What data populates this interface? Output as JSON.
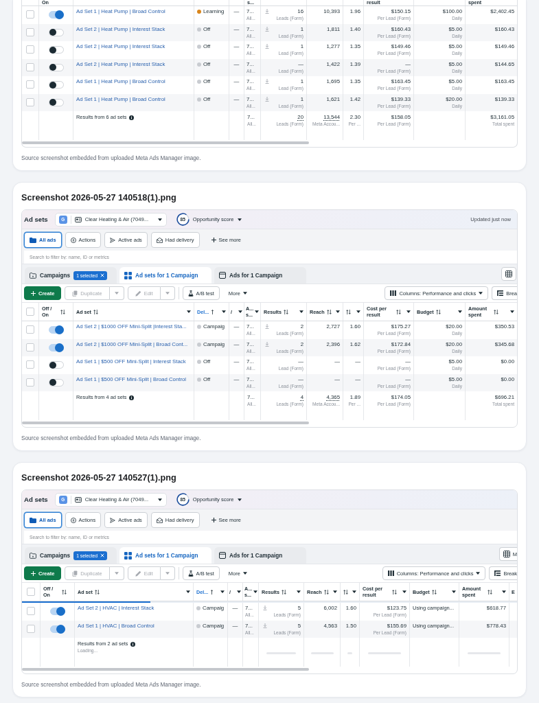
{
  "cards": [
    {
      "table": {
        "columns": [
          {
            "kind": "cut"
          },
          {
            "kind": "cut",
            "label": "On"
          },
          {
            "kind": "cut"
          },
          {
            "kind": "cut"
          },
          {
            "kind": "cut"
          },
          {
            "kind": "cut",
            "label": "s..."
          },
          {
            "kind": "cut"
          },
          {
            "kind": "cut"
          },
          {
            "kind": "cut"
          },
          {
            "kind": "cut",
            "label": "result"
          },
          {
            "kind": "cut"
          },
          {
            "kind": "cut",
            "label": "spent"
          }
        ],
        "rows": [
          {
            "selected": false,
            "on": true,
            "name": "Ad Set 1 | Heat Pump | Broad Control",
            "delivery": {
              "label": "Learning",
              "color": "#d9861c"
            },
            "column_5": "—",
            "column_6": {
              "value": "7...",
              "sub": "All..."
            },
            "results": {
              "value": "16",
              "sub": "Leads (Form)",
              "icon": true
            },
            "reach": "10,393",
            "column_9": "1.96",
            "cost_per_result": {
              "value": "$150.15",
              "sub": "Per Lead (Form)"
            },
            "budget": {
              "value": "$100.00",
              "sub": "Daily"
            },
            "amount_spent": "$2,402.45"
          },
          {
            "selected": false,
            "on": false,
            "name": "Ad Set 2 | Heat Pump | Interest Stack",
            "delivery": {
              "label": "Off",
              "color": "#c9ccd1"
            },
            "column_5": "—",
            "column_6": {
              "value": "7...",
              "sub": "All..."
            },
            "results": {
              "value": "1",
              "sub": "Lead (Form)",
              "icon": true
            },
            "reach": "1,811",
            "column_9": "1.40",
            "cost_per_result": {
              "value": "$160.43",
              "sub": "Per Lead (Form)"
            },
            "budget": {
              "value": "$5.00",
              "sub": "Daily"
            },
            "amount_spent": "$160.43"
          },
          {
            "selected": false,
            "on": false,
            "name": "Ad Set 2 | Heat Pump | Interest Stack",
            "delivery": {
              "label": "Off",
              "color": "#c9ccd1"
            },
            "column_5": "—",
            "column_6": {
              "value": "7...",
              "sub": "All..."
            },
            "results": {
              "value": "1",
              "sub": "Lead (Form)",
              "icon": true
            },
            "reach": "1,277",
            "column_9": "1.35",
            "cost_per_result": {
              "value": "$149.46",
              "sub": "Per Lead (Form)"
            },
            "budget": {
              "value": "$5.00",
              "sub": "Daily"
            },
            "amount_spent": "$149.46"
          },
          {
            "selected": false,
            "on": false,
            "name": "Ad Set 2 | Heat Pump | Interest Stack",
            "delivery": {
              "label": "Off",
              "color": "#c9ccd1"
            },
            "column_5": "—",
            "column_6": {
              "value": "7...",
              "sub": "All..."
            },
            "results": {
              "value": "—",
              "sub": "Lead (Form)",
              "icon": false
            },
            "reach": "1,422",
            "column_9": "1.39",
            "cost_per_result": {
              "value": "—",
              "sub": "Per Lead (Form)"
            },
            "budget": {
              "value": "$5.00",
              "sub": "Daily"
            },
            "amount_spent": "$144.65"
          },
          {
            "selected": false,
            "on": false,
            "name": "Ad Set 1 | Heat Pump | Broad Control",
            "delivery": {
              "label": "Off",
              "color": "#c9ccd1"
            },
            "column_5": "—",
            "column_6": {
              "value": "7...",
              "sub": "All..."
            },
            "results": {
              "value": "1",
              "sub": "Lead (Form)",
              "icon": true
            },
            "reach": "1,695",
            "column_9": "1.35",
            "cost_per_result": {
              "value": "$163.45",
              "sub": "Per Lead (Form)"
            },
            "budget": {
              "value": "$5.00",
              "sub": "Daily"
            },
            "amount_spent": "$163.45"
          },
          {
            "selected": false,
            "on": false,
            "name": "Ad Set 1 | Heat Pump | Broad Control",
            "delivery": {
              "label": "Off",
              "color": "#c9ccd1"
            },
            "column_5": "—",
            "column_6": {
              "value": "7...",
              "sub": "All..."
            },
            "results": {
              "value": "1",
              "sub": "Lead (Form)",
              "icon": true
            },
            "reach": "1,621",
            "column_9": "1.42",
            "cost_per_result": {
              "value": "$139.33",
              "sub": "Per Lead (Form)"
            },
            "budget": {
              "value": "$20.00",
              "sub": "Daily"
            },
            "amount_spent": "$139.33"
          }
        ],
        "totals": {
          "label": "Results from 6 ad sets",
          "loading": false,
          "column_6": {
            "value": "7...",
            "sub": "All..."
          },
          "results": {
            "value": "20",
            "sub": "Leads (Form)"
          },
          "reach": {
            "value": "13,544",
            "sub": "Meta Accou..."
          },
          "column_9": {
            "value": "2.30",
            "sub": "Per ..."
          },
          "cost_per_result": {
            "value": "$158.05",
            "sub": "Per Lead (Form)"
          },
          "amount_spent": {
            "value": "$3,161.05",
            "sub": "Total spent"
          }
        }
      },
      "caption": "Source screenshot embedded from uploaded Meta Ads Manager image."
    },
    {
      "title": "Screenshot 2026-05-27 140518(1).png",
      "top_bar": {
        "title": "Ad sets",
        "account": {
          "initial": "G",
          "name": "Clear Heating & Air (7049..."
        },
        "score": {
          "value": "85",
          "label": "Opportunity score"
        },
        "status": "Updated just now"
      },
      "filters": [
        {
          "label": "All ads",
          "selected": true
        },
        {
          "label": "Actions",
          "selected": false
        },
        {
          "label": "Active ads",
          "selected": false
        },
        {
          "label": "Had delivery",
          "selected": false
        }
      ],
      "see_more": "See more",
      "search": {
        "placeholder": "Search to filter by: name, ID or metrics"
      },
      "tabs": [
        {
          "label": "Campaigns",
          "selected": false,
          "badge": "1 selected"
        },
        {
          "label": "Ad sets for 1 Campaign",
          "selected": true
        },
        {
          "label": "Ads for 1 Campaign",
          "selected": false
        }
      ],
      "toolbar": {
        "create": "Create",
        "duplicate": {
          "label": "Duplicate",
          "disabled": true
        },
        "edit": {
          "label": "Edit",
          "disabled": true
        },
        "ab_test": "A/B test",
        "more": "More",
        "columns": "Columns: Performance and clicks",
        "breakdown": "Brea"
      },
      "table": {
        "columns": [
          {
            "kind": "check",
            "checked": false
          },
          {
            "kind": "head",
            "label": "Off / On",
            "sortable": true,
            "sorted": false,
            "menu": false
          },
          {
            "kind": "head",
            "label": "Ad set",
            "sortable": true,
            "sorted": false,
            "menu": true
          },
          {
            "kind": "head",
            "label": "Del...",
            "sortable": false,
            "sorted": true,
            "menu": true
          },
          {
            "kind": "head",
            "label": "/",
            "sortable": false,
            "sorted": false,
            "menu": true
          },
          {
            "kind": "head",
            "label": "A... s...",
            "sortable": false,
            "sorted": false,
            "menu": true
          },
          {
            "kind": "head",
            "label": "Results",
            "sortable": true,
            "sorted": false,
            "menu": true
          },
          {
            "kind": "head",
            "label": "Reach",
            "sortable": true,
            "sorted": false,
            "menu": true
          },
          {
            "kind": "head",
            "sortable": true,
            "sorted": false,
            "menu": true
          },
          {
            "kind": "head",
            "label": "Cost per result",
            "sortable": true,
            "sorted": false,
            "menu": true
          },
          {
            "kind": "head",
            "label": "Budget",
            "sortable": true,
            "sorted": false,
            "menu": true
          },
          {
            "kind": "head",
            "label": "Amount spent",
            "sortable": true,
            "sorted": false,
            "menu": true
          }
        ],
        "rows": [
          {
            "selected": false,
            "on": true,
            "name": "Ad Set 2 | $1000 OFF Mini-Split |Interest Sta...",
            "delivery": {
              "label": "Campaig",
              "color": "#c9ccd1"
            },
            "column_5": "—",
            "column_6": {
              "value": "7...",
              "sub": "All..."
            },
            "results": {
              "value": "2",
              "sub": "Leads (Form)",
              "icon": true
            },
            "reach": "2,727",
            "column_9": "1.60",
            "cost_per_result": {
              "value": "$175.27",
              "sub": "Per Lead (Form)"
            },
            "budget": {
              "value": "$20.00",
              "sub": "Daily"
            },
            "amount_spent": "$350.53"
          },
          {
            "selected": false,
            "on": true,
            "name": "Ad Set 2 | $1000 OFF Mini-Split | Broad Cont...",
            "delivery": {
              "label": "Campaig",
              "color": "#c9ccd1"
            },
            "column_5": "—",
            "column_6": {
              "value": "7...",
              "sub": "All..."
            },
            "results": {
              "value": "2",
              "sub": "Leads (Form)",
              "icon": true
            },
            "reach": "2,396",
            "column_9": "1.62",
            "cost_per_result": {
              "value": "$172.84",
              "sub": "Per Lead (Form)"
            },
            "budget": {
              "value": "$20.00",
              "sub": "Daily"
            },
            "amount_spent": "$345.68"
          },
          {
            "selected": false,
            "on": false,
            "name": "Ad Set 1 | $500 OFF Mini-Split | Interest Stack",
            "delivery": {
              "label": "Off",
              "color": "#c9ccd1"
            },
            "column_5": "—",
            "column_6": {
              "value": "7...",
              "sub": "All..."
            },
            "results": {
              "value": "—",
              "sub": "Lead (Form)",
              "icon": false
            },
            "reach": "—",
            "column_9": "—",
            "cost_per_result": {
              "value": "—",
              "sub": "Per Lead (Form)"
            },
            "budget": {
              "value": "$5.00",
              "sub": "Daily"
            },
            "amount_spent": "$0.00"
          },
          {
            "selected": false,
            "on": false,
            "name": "Ad Set 1 | $500 OFF Mini-Split | Broad Control",
            "delivery": {
              "label": "Off",
              "color": "#c9ccd1"
            },
            "column_5": "—",
            "column_6": {
              "value": "7...",
              "sub": "All..."
            },
            "results": {
              "value": "—",
              "sub": "Lead (Form)",
              "icon": false
            },
            "reach": "—",
            "column_9": "—",
            "cost_per_result": {
              "value": "—",
              "sub": "Per Lead (Form)"
            },
            "budget": {
              "value": "$5.00",
              "sub": "Daily"
            },
            "amount_spent": "$0.00"
          }
        ],
        "totals": {
          "label": "Results from 4 ad sets",
          "loading": false,
          "column_6": {
            "value": "7...",
            "sub": "All..."
          },
          "results": {
            "value": "4",
            "sub": "Leads (Form)"
          },
          "reach": {
            "value": "4,365",
            "sub": "Meta Accou..."
          },
          "column_9": {
            "value": "1.89",
            "sub": "Per ..."
          },
          "cost_per_result": {
            "value": "$174.05",
            "sub": "Per Lead (Form)"
          },
          "amount_spent": {
            "value": "$696.21",
            "sub": "Total spent"
          }
        }
      },
      "caption": "Source screenshot embedded from uploaded Meta Ads Manager image."
    },
    {
      "title": "Screenshot 2026-05-27 140527(1).png",
      "top_bar": {
        "title": "Ad sets",
        "account": {
          "initial": "G",
          "name": "Clear Heating & Air (7049..."
        },
        "score": {
          "value": "85",
          "label": "Opportunity score"
        }
      },
      "filters": [
        {
          "label": "All ads",
          "selected": true
        },
        {
          "label": "Actions",
          "selected": false
        },
        {
          "label": "Active ads",
          "selected": false
        },
        {
          "label": "Had delivery",
          "selected": false
        }
      ],
      "see_more": "See more",
      "search": {
        "placeholder": "Search to filter by: name, ID or metrics"
      },
      "tabs": [
        {
          "label": "Campaigns",
          "selected": false,
          "badge": "1 selected"
        },
        {
          "label": "Ad sets for 1 Campaign",
          "selected": true
        },
        {
          "label": "Ads for 1 Campaign",
          "selected": false
        }
      ],
      "view_button": {
        "label": "M"
      },
      "toolbar": {
        "create": "Create",
        "duplicate": {
          "label": "Duplicate",
          "disabled": true
        },
        "edit": {
          "label": "Edit",
          "disabled": true
        },
        "ab_test": "A/B test",
        "more": "More",
        "columns": "Columns: Performance and clicks",
        "breakdown": "Break"
      },
      "table": {
        "columns": [
          {
            "kind": "check",
            "checked": false
          },
          {
            "kind": "head",
            "label": "Off / On",
            "sortable": true,
            "sorted": false,
            "menu": false
          },
          {
            "kind": "head",
            "label": "Ad set",
            "sortable": true,
            "sorted": false,
            "menu": true
          },
          {
            "kind": "head",
            "label": "Del...",
            "sortable": false,
            "sorted": true,
            "menu": true
          },
          {
            "kind": "head",
            "label": "/",
            "sortable": false,
            "sorted": false,
            "menu": true
          },
          {
            "kind": "head",
            "label": "A... s...",
            "sortable": false,
            "sorted": false,
            "menu": true
          },
          {
            "kind": "head",
            "label": "Results",
            "sortable": true,
            "sorted": false,
            "menu": true
          },
          {
            "kind": "head",
            "label": "Reach",
            "sortable": true,
            "sorted": false,
            "menu": true
          },
          {
            "kind": "head",
            "sortable": true,
            "sorted": false,
            "menu": true
          },
          {
            "kind": "head",
            "label": "Cost per result",
            "sortable": true,
            "sorted": false,
            "menu": true
          },
          {
            "kind": "head",
            "label": "Budget",
            "sortable": true,
            "sorted": false,
            "menu": true
          },
          {
            "kind": "head",
            "label": "Amount spent",
            "sortable": true,
            "sorted": false,
            "menu": true
          },
          {
            "kind": "cut",
            "label": "E"
          }
        ],
        "progress": {
          "level": 0.26
        },
        "rows": [
          {
            "selected": false,
            "on": true,
            "name": "Ad Set 2 | HVAC | Interest Stack",
            "delivery": {
              "label": "Campaig",
              "color": "#c9ccd1"
            },
            "column_5": "—",
            "column_6": {
              "value": "7...",
              "sub": "All..."
            },
            "results": {
              "value": "5",
              "sub": "Leads (Form)",
              "icon": true
            },
            "reach": "6,002",
            "column_9": "1.60",
            "cost_per_result": {
              "value": "$123.75",
              "sub": "Per Lead (Form)"
            },
            "budget": {
              "value": "Using campaign..."
            },
            "amount_spent": "$618.77"
          },
          {
            "selected": false,
            "on": true,
            "name": "Ad Set 1 | HVAC | Broad Control",
            "delivery": {
              "label": "Campaig",
              "color": "#c9ccd1"
            },
            "column_5": "—",
            "column_6": {
              "value": "7...",
              "sub": "All..."
            },
            "results": {
              "value": "5",
              "sub": "Leads (Form)",
              "icon": true
            },
            "reach": "4,563",
            "column_9": "1.50",
            "cost_per_result": {
              "value": "$155.69",
              "sub": "Per Lead (Form)"
            },
            "budget": {
              "value": "Using campaign..."
            },
            "amount_spent": "$778.43"
          }
        ],
        "totals": {
          "label": "Results from 2 ad sets",
          "sub": "Loading...",
          "loading": true
        }
      },
      "caption": "Source screenshot embedded from uploaded Meta Ads Manager image."
    }
  ]
}
